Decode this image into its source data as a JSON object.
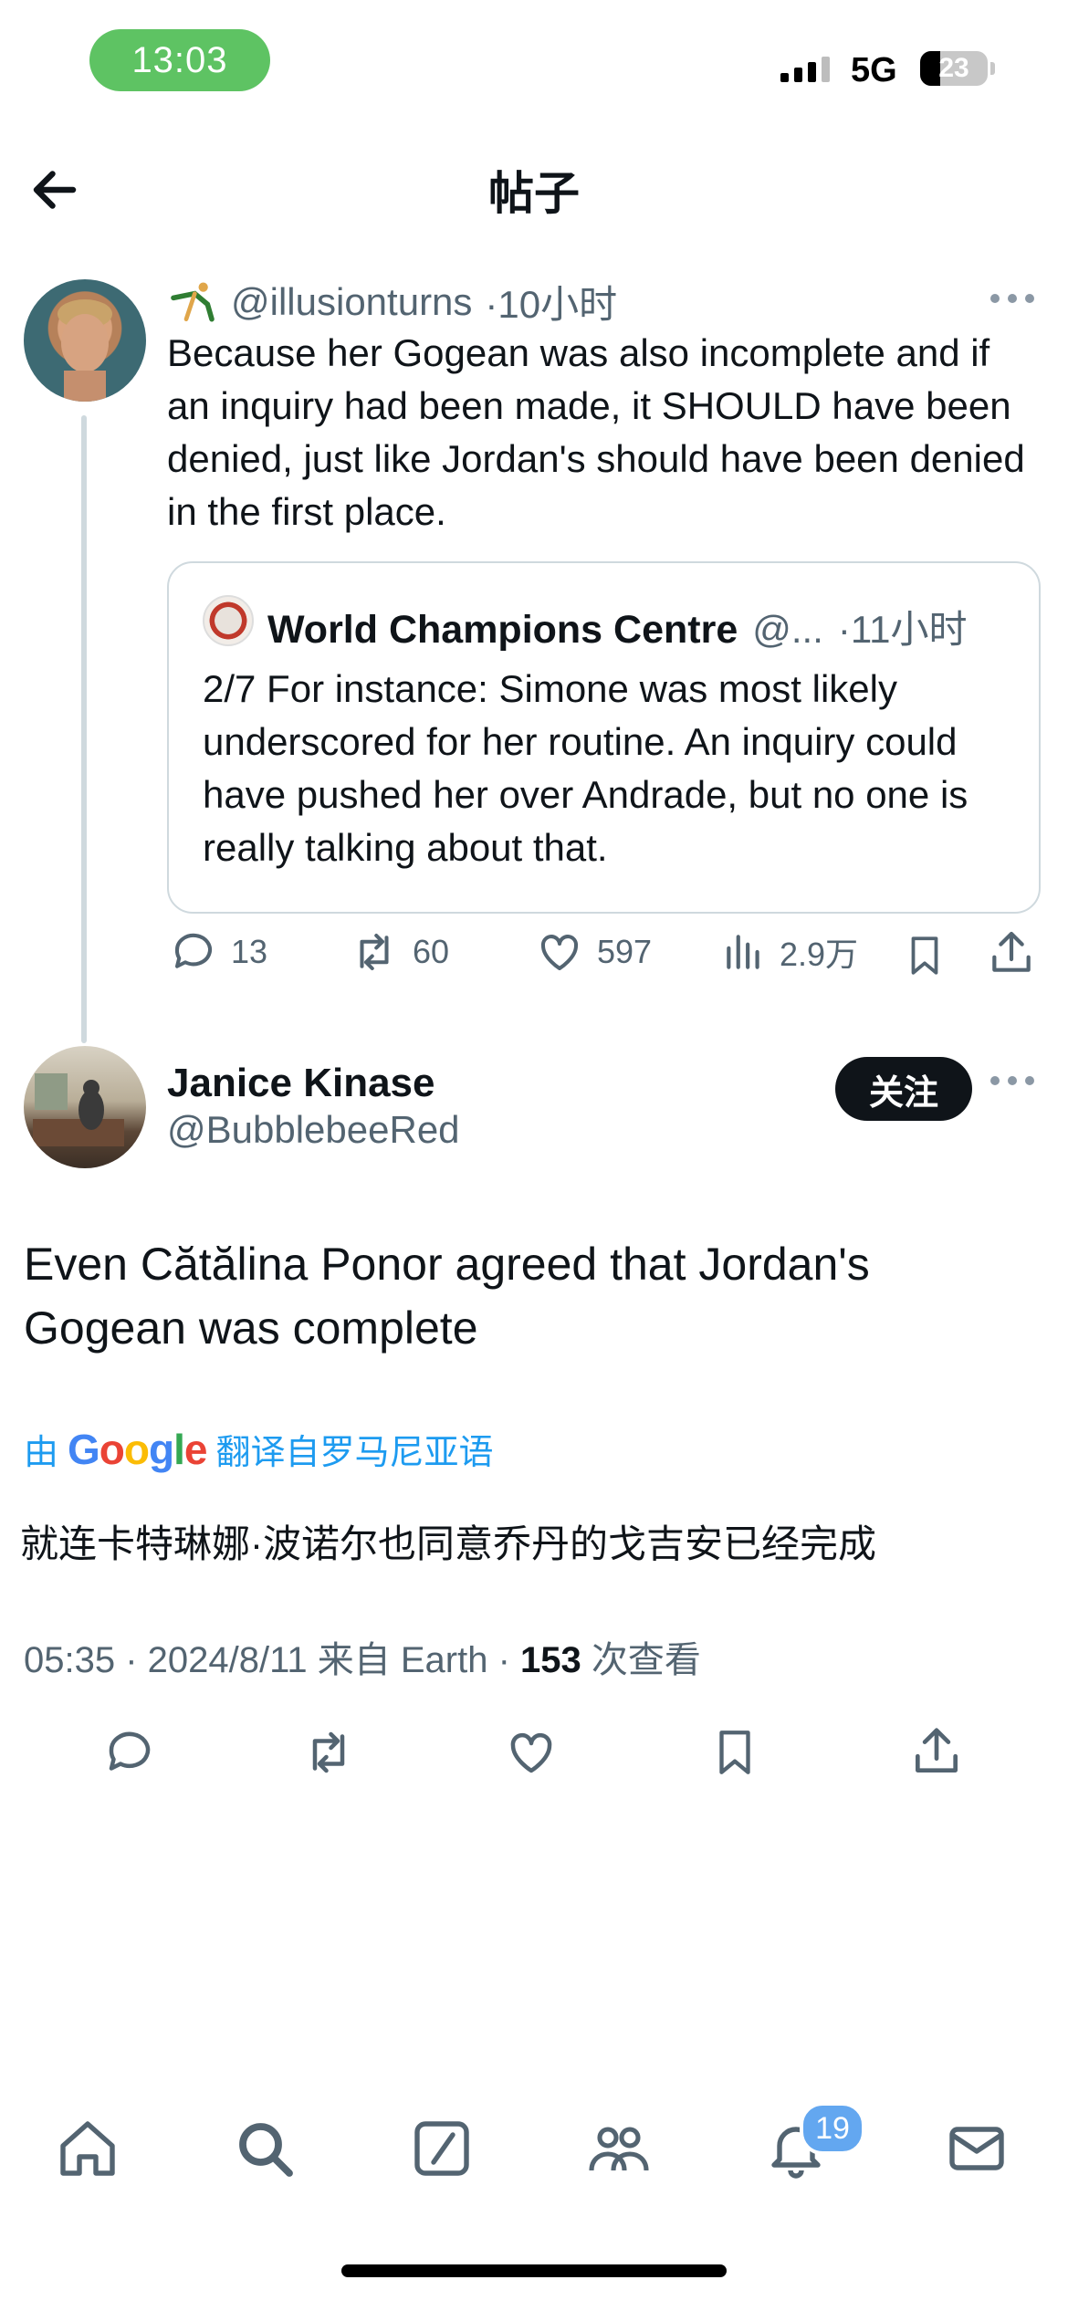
{
  "status_bar": {
    "time": "13:03",
    "network": "5G",
    "battery": "23"
  },
  "header": {
    "title": "帖子",
    "back_icon": "arrow-left-icon"
  },
  "reply_tweet": {
    "handle": "@illusionturns",
    "time": "·10小时",
    "text": "Because her Gogean was also incomplete and if an inquiry had been made, it SHOULD have been denied, just like Jordan's should have been denied in the first place.",
    "quote": {
      "name": "World Champions Centre",
      "handle": "@...",
      "time": "·11小时",
      "text": "2/7 For instance: Simone was most likely underscored for her routine. An inquiry could have pushed her over Andrade, but no one is really talking about that."
    },
    "stats": {
      "replies": "13",
      "retweets": "60",
      "likes": "597",
      "views": "2.9万"
    }
  },
  "main_tweet": {
    "name": "Janice Kinase",
    "handle": "@BubblebeeRed",
    "follow_label": "关注",
    "text": "Even Cătălina Ponor agreed that Jordan's Gogean was complete",
    "translate_prefix": "由",
    "translate_brand": "Google",
    "translate_suffix": "翻译自罗马尼亚语",
    "translation": "就连卡特琳娜·波诺尔也同意乔丹的戈吉安已经完成",
    "timestamp": "05:35 · 2024/8/11 来自 Earth · ",
    "views_count": "153",
    "views_label": " 次查看"
  },
  "tab_bar": {
    "items": [
      "home-icon",
      "search-icon",
      "compose-icon",
      "communities-icon",
      "notifications-icon",
      "messages-icon"
    ],
    "notification_badge": "19"
  },
  "colors": {
    "accent": "#1d9bf0",
    "text": "#0f1419",
    "secondary": "#536471",
    "status_pill": "#5ec363"
  }
}
